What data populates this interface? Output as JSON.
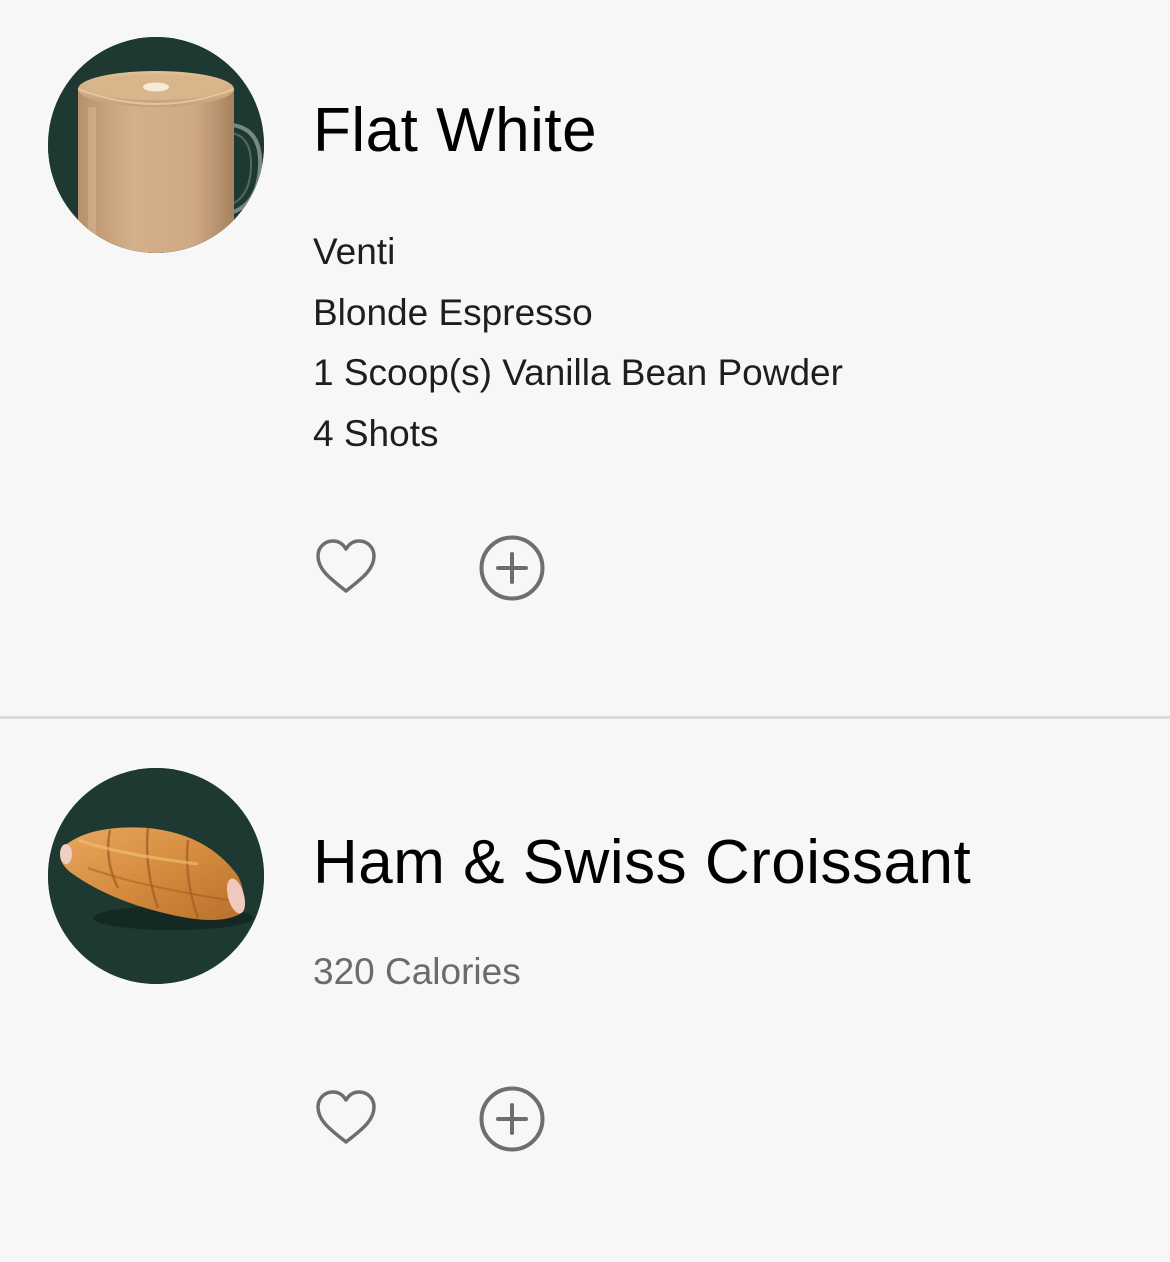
{
  "items": [
    {
      "name": "Flat White",
      "image": "flat-white-mug",
      "options": [
        "Venti",
        "Blonde Espresso",
        "1 Scoop(s) Vanilla Bean Powder",
        "4 Shots"
      ],
      "actions": {
        "favorite_icon": "heart-outline-icon",
        "add_icon": "plus-circle-icon"
      }
    },
    {
      "name": "Ham & Swiss Croissant",
      "image": "ham-swiss-croissant",
      "calories": "320 Calories",
      "actions": {
        "favorite_icon": "heart-outline-icon",
        "add_icon": "plus-circle-icon"
      }
    }
  ],
  "colors": {
    "background": "#f7f7f7",
    "thumbnail_bg": "#1e3932",
    "title": "#000000",
    "detail_text": "#1e1e1e",
    "calories_text": "#6b6b6b",
    "icon": "#6e6e6e",
    "divider": "#dcdcdc"
  }
}
